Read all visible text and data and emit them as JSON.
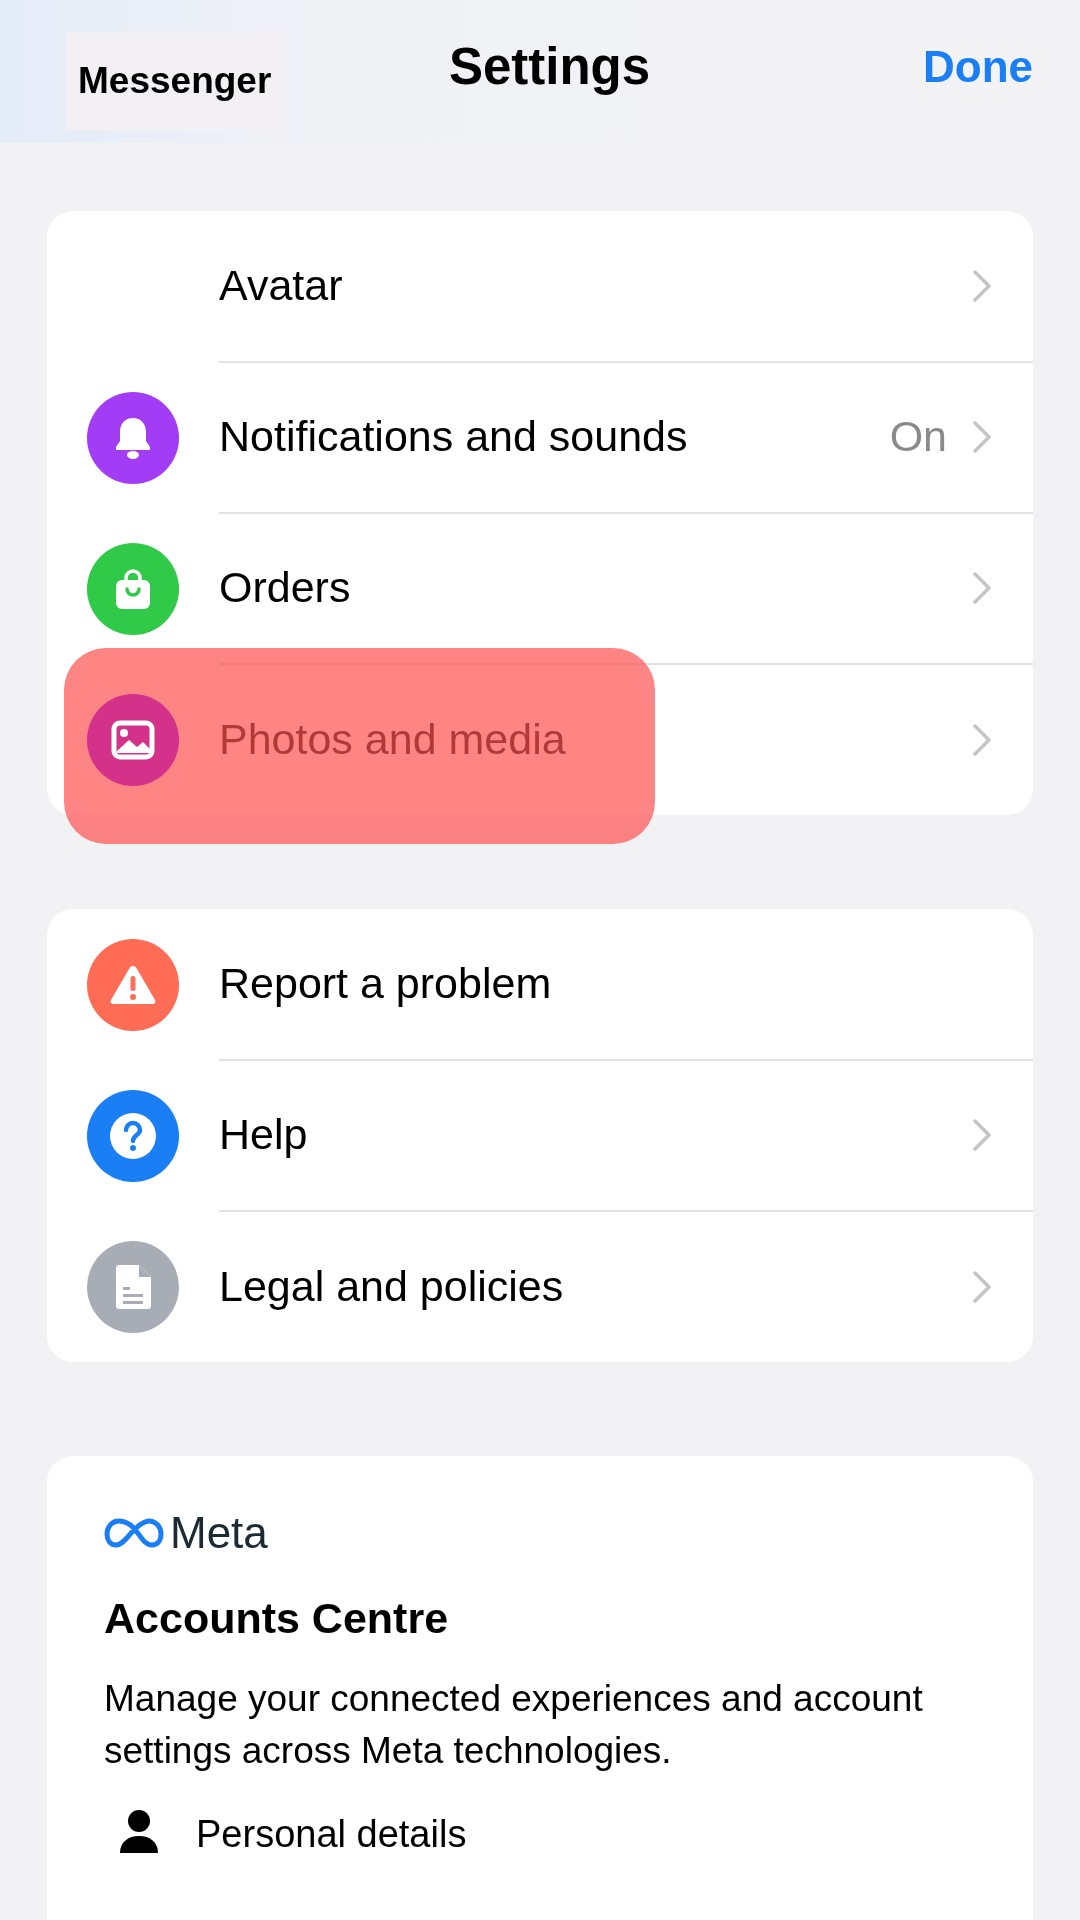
{
  "header": {
    "back": "Messenger",
    "title": "Settings",
    "done": "Done"
  },
  "groups": [
    {
      "rows": [
        {
          "label": "Avatar",
          "chevron": true,
          "highlighted": false
        },
        {
          "label": "Notifications and sounds",
          "color": "#a33cf5",
          "value": "On",
          "chevron": true,
          "highlighted": false
        },
        {
          "label": "Orders",
          "color": "#31c948",
          "chevron": true,
          "highlighted": false
        },
        {
          "label": "Photos and media",
          "color": "#d4318a",
          "chevron": true,
          "highlighted": true
        }
      ]
    },
    {
      "rows": [
        {
          "label": "Report a problem",
          "color": "#fe6c55",
          "chevron": false,
          "highlighted": false
        },
        {
          "label": "Help",
          "color": "#1a7ef5",
          "chevron": true,
          "highlighted": false
        },
        {
          "label": "Legal and policies",
          "color": "#a7acb5",
          "chevron": true,
          "highlighted": false
        }
      ]
    }
  ],
  "accounts": {
    "brand": "Meta",
    "title": "Accounts Centre",
    "description": "Manage your connected experiences and account settings across Meta technologies.",
    "items": [
      {
        "label": "Personal details"
      }
    ]
  }
}
